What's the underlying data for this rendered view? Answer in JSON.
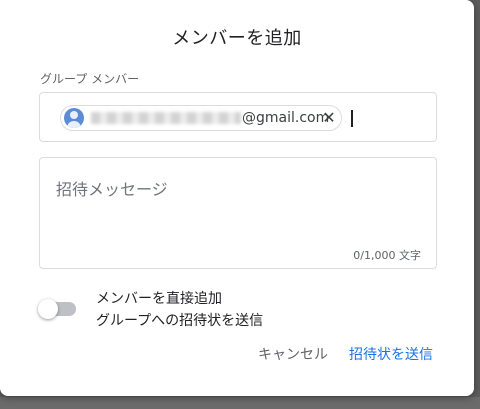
{
  "dialog": {
    "title": "メンバーを追加",
    "group_members_label": "グループ メンバー",
    "member_chip": {
      "email_domain": "@gmail.com",
      "remove_icon": "close-icon",
      "avatar_icon": "person-avatar-icon"
    },
    "message": {
      "placeholder": "招待メッセージ",
      "counter": "0/1,000 文字"
    },
    "direct_add": {
      "title": "メンバーを直接追加",
      "subtitle": "グループへの招待状を送信",
      "enabled": false
    },
    "buttons": {
      "cancel": "キャンセル",
      "send": "招待状を送信"
    }
  },
  "colors": {
    "accent": "#1a73e8",
    "avatar": "#5d8bd8",
    "border": "#dadce0"
  }
}
